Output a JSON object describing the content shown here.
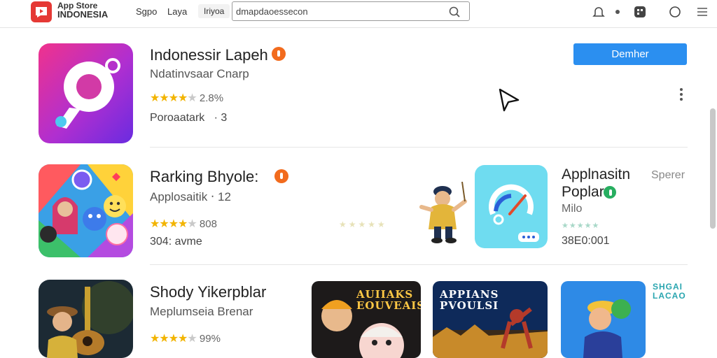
{
  "header": {
    "brand_line1": "App Store",
    "brand_line2": "INDONESIA",
    "nav_items": [
      "Sgpo",
      "Laya",
      "Iriyoa"
    ],
    "search": {
      "value": "dmapdaoessecon",
      "placeholder": "dmapdaoessecon"
    }
  },
  "apps": [
    {
      "title": "Indonessir Lapeh",
      "subtitle": "Ndatinvsaar Cnarp",
      "stars": 4.5,
      "rating": "2.8%",
      "meta_1": "Poroaatark",
      "meta_sep": "·",
      "meta_2": "3",
      "button_label": "Demher"
    },
    {
      "title": "Rarking Bhyole:",
      "subtitle": "Applosaitik ‧ 12",
      "stars": 4.5,
      "rating": "808",
      "meta": "304: avme"
    },
    {
      "title": "Shody Yikerpblar",
      "subtitle": "Meplumseia Brenar",
      "stars": 4.5,
      "rating": "99%"
    }
  ],
  "featured": {
    "title_line1": "Applnasitn",
    "side_label": "Sperer",
    "title_line2": "Poplar",
    "subtitle": "Milo",
    "meta": "38E0:001"
  },
  "cards": [
    {
      "text": "AUIIAKS\nEOUVEAIS"
    },
    {
      "text": "APPIANS\nPVOULSI"
    },
    {
      "text": "SHGAI\nLACAO"
    }
  ],
  "colors": {
    "accent": "#2b8ff0",
    "star": "#f2b400",
    "badge_orange": "#f26b1d",
    "badge_green": "#27ae60",
    "logo": "#e53935"
  },
  "icons": [
    "search-icon",
    "bell-icon",
    "dot-icon",
    "grid-icon",
    "circle-icon",
    "more-vertical-icon",
    "cursor-icon",
    "verified-badge-icon"
  ]
}
